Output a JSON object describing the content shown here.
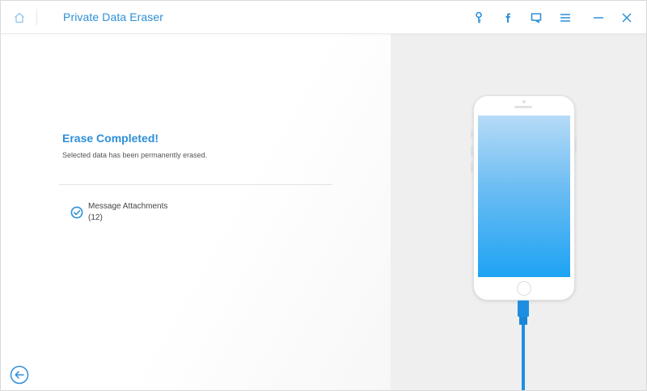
{
  "titlebar": {
    "app_title": "Private Data Eraser",
    "icons": [
      "home-icon",
      "key-icon",
      "facebook-icon",
      "feedback-icon",
      "menu-icon",
      "minimize-icon",
      "close-icon"
    ]
  },
  "result": {
    "title": "Erase Completed!",
    "subtitle": "Selected data has been permanently erased.",
    "items": [
      {
        "name": "Message Attachments",
        "count": "(12)",
        "status_icon": "check-circle-icon"
      }
    ]
  },
  "footer": {
    "back_icon": "back-arrow-icon"
  },
  "colors": {
    "accent": "#2d8fd8",
    "right_pane_bg": "#efefef",
    "screen_gradient_top": "#b6dbf7",
    "screen_gradient_bottom": "#1ea3f3",
    "cable": "#1e8fe0"
  }
}
